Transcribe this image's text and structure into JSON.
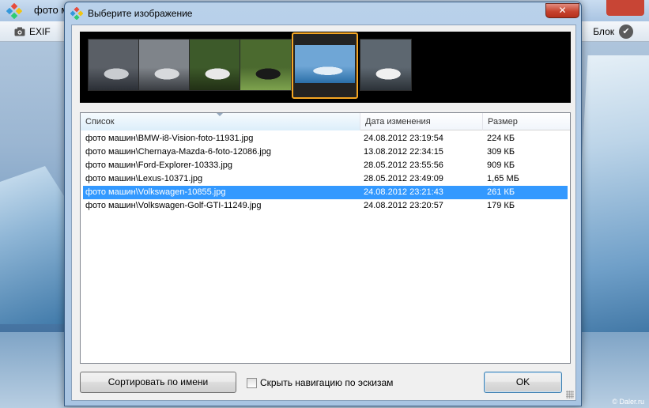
{
  "background_app": {
    "title": "фото машин",
    "toolbar": {
      "exif_label": "EXIF",
      "block_label": "Блок"
    },
    "watermark": "© Daler.ru"
  },
  "dialog": {
    "title": "Выберите изображение",
    "close_label": "✕",
    "thumbnails": [
      {
        "name": "BMW-i8-Vision",
        "colors": [
          "#5a5f66",
          "#c9ccd0",
          "#2b2f36"
        ]
      },
      {
        "name": "Chernaya-Mazda-6",
        "colors": [
          "#7f848a",
          "#d7d9dc",
          "#3a3d42"
        ]
      },
      {
        "name": "Ford-Explorer",
        "colors": [
          "#3d5a2a",
          "#e8e8e8",
          "#223015"
        ]
      },
      {
        "name": "Lexus",
        "colors": [
          "#4b6a2f",
          "#1a1a1a",
          "#7ea34e"
        ]
      },
      {
        "name": "Volkswagen",
        "colors": [
          "#6fa6d6",
          "#e3eef7",
          "#2b6fa8"
        ]
      },
      {
        "name": "Volkswagen-Golf-GTI",
        "colors": [
          "#5d6770",
          "#f0f0f0",
          "#2c3238"
        ]
      }
    ],
    "selected_thumbnail_index": 4,
    "list": {
      "columns": {
        "name": "Список",
        "date": "Дата изменения",
        "size": "Размер"
      },
      "rows": [
        {
          "name": "фото машин\\BMW-i8-Vision-foto-11931.jpg",
          "date": "24.08.2012 23:19:54",
          "size": "224 КБ"
        },
        {
          "name": "фото машин\\Chernaya-Mazda-6-foto-12086.jpg",
          "date": "13.08.2012 22:34:15",
          "size": "309 КБ"
        },
        {
          "name": "фото машин\\Ford-Explorer-10333.jpg",
          "date": "28.05.2012 23:55:56",
          "size": "909 КБ"
        },
        {
          "name": "фото машин\\Lexus-10371.jpg",
          "date": "28.05.2012 23:49:09",
          "size": "1,65 МБ"
        },
        {
          "name": "фото машин\\Volkswagen-10855.jpg",
          "date": "24.08.2012 23:21:43",
          "size": "261 КБ"
        },
        {
          "name": "фото машин\\Volkswagen-Golf-GTI-11249.jpg",
          "date": "24.08.2012 23:20:57",
          "size": "179 КБ"
        }
      ],
      "selected_row_index": 4
    },
    "buttons": {
      "sort_label": "Сортировать по имени",
      "ok_label": "OK"
    },
    "hide_thumbnails_checkbox": {
      "label": "Скрыть навигацию по эскизам",
      "checked": false
    }
  },
  "colors": {
    "selection": "#3399ff",
    "thumb_highlight": "#f5a623",
    "close_red": "#c7432f"
  }
}
